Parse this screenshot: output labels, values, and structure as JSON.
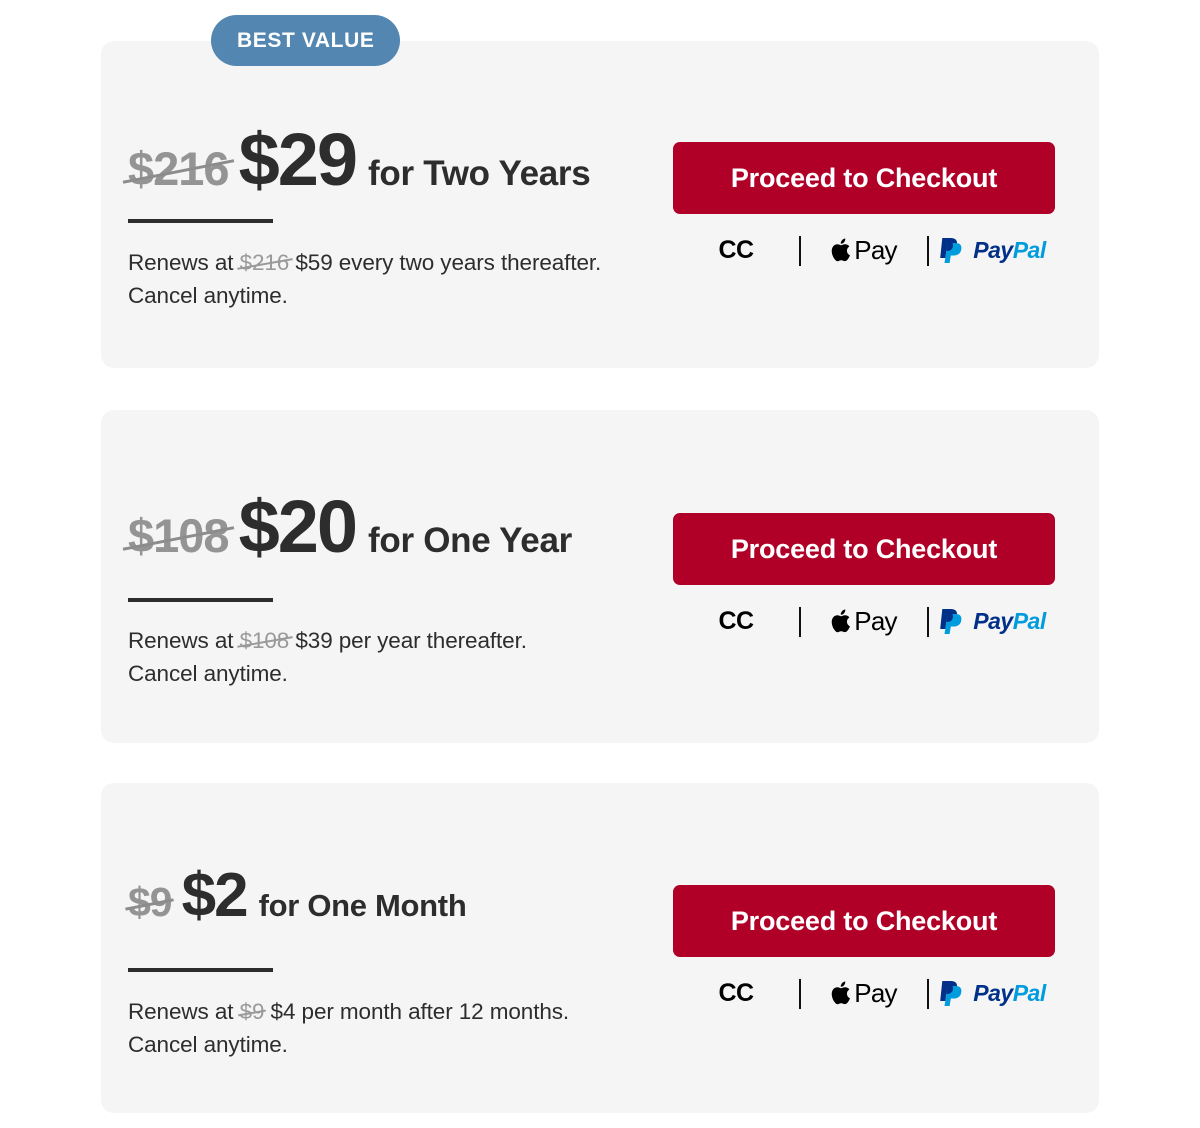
{
  "badge": {
    "label": "BEST VALUE"
  },
  "colors": {
    "badge_blue": "#5386B0",
    "checkout_red": "#B10027",
    "card_background": "#F5F5F5",
    "page_background": "#FFFFFF",
    "strike_gray": "#949494",
    "text_dark": "#2D2D2D",
    "paypal_dark": "#003087",
    "paypal_light": "#009CDE"
  },
  "payment": {
    "cc_label": "CC",
    "apple_pay_label": "Pay",
    "paypal_pay": "Pay",
    "paypal_pal": "Pal"
  },
  "plans": [
    {
      "old_price": "$216",
      "new_price": "$29",
      "term": "for Two Years",
      "renew_prefix": "Renews at",
      "renew_old_price": "$216",
      "renew_text": "$59 every two years thereafter.",
      "renew_line2": "Cancel anytime.",
      "cta": "Proceed to Checkout",
      "badge": "BEST VALUE"
    },
    {
      "old_price": "$108",
      "new_price": "$20",
      "term": "for One Year",
      "renew_prefix": "Renews at",
      "renew_old_price": "$108",
      "renew_text": "$39 per year thereafter.",
      "renew_line2": "Cancel anytime.",
      "cta": "Proceed to Checkout"
    },
    {
      "old_price": "$9",
      "new_price": "$2",
      "term": "for One Month",
      "renew_prefix": "Renews at",
      "renew_old_price": "$9",
      "renew_text": "$4 per month after 12 months.",
      "renew_line2": "Cancel anytime.",
      "cta": "Proceed to Checkout"
    }
  ]
}
